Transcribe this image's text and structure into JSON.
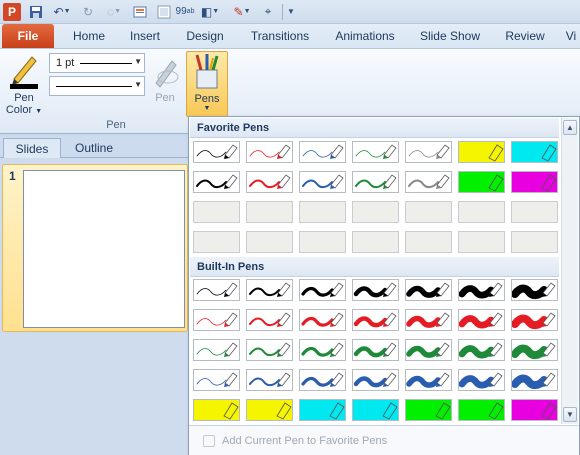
{
  "qat": {
    "logo_letter": "P",
    "icons": [
      "powerpoint-logo-icon",
      "save-icon",
      "undo-icon",
      "redo-icon",
      "repeat-icon",
      "new-slide-icon",
      "print-icon",
      "spelling-icon",
      "shapes-icon",
      "pen-color-icon",
      "pointer-icon",
      "customize-qat-icon"
    ]
  },
  "tabs": [
    "File",
    "Home",
    "Insert",
    "Design",
    "Transitions",
    "Animations",
    "Slide Show",
    "Review",
    "Vi"
  ],
  "ribbon": {
    "pen_color_label_1": "Pen",
    "pen_color_label_2": "Color",
    "thickness_value": "1 pt",
    "pen_disabled_label": "Pen",
    "pens_button_label": "Pens",
    "group_label": "Pen"
  },
  "pane": {
    "tabs": [
      "Slides",
      "Outline"
    ],
    "slide_number": "1"
  },
  "gallery": {
    "favorite_header": "Favorite Pens",
    "builtin_header": "Built-In Pens",
    "footer_label": "Add Current Pen to Favorite Pens",
    "colors": {
      "black": "#000000",
      "red": "#e51c23",
      "blue": "#2a5db0",
      "green": "#1f8a3a",
      "gray": "#888888",
      "yellow": "#f5f500",
      "cyan": "#00e8f0",
      "lime": "#00f000",
      "magenta": "#e800e0"
    },
    "favorites": [
      [
        {
          "color": "black",
          "weight": 1
        },
        {
          "color": "red",
          "weight": 1
        },
        {
          "color": "blue",
          "weight": 1
        },
        {
          "color": "green",
          "weight": 1
        },
        {
          "color": "gray",
          "weight": 1
        },
        {
          "color": "yellow",
          "weight": "hl"
        },
        {
          "color": "cyan",
          "weight": "hl"
        }
      ],
      [
        {
          "color": "black",
          "weight": 2
        },
        {
          "color": "red",
          "weight": 2
        },
        {
          "color": "blue",
          "weight": 2
        },
        {
          "color": "green",
          "weight": 2
        },
        {
          "color": "gray",
          "weight": 2
        },
        {
          "color": "lime",
          "weight": "hl"
        },
        {
          "color": "magenta",
          "weight": "hl"
        }
      ],
      [
        null,
        null,
        null,
        null,
        null,
        null,
        null
      ],
      [
        null,
        null,
        null,
        null,
        null,
        null,
        null
      ]
    ],
    "builtin": [
      [
        {
          "color": "black",
          "weight": 1
        },
        {
          "color": "black",
          "weight": 2
        },
        {
          "color": "black",
          "weight": 3
        },
        {
          "color": "black",
          "weight": 4
        },
        {
          "color": "black",
          "weight": 5
        },
        {
          "color": "black",
          "weight": 6
        },
        {
          "color": "black",
          "weight": 7
        }
      ],
      [
        {
          "color": "red",
          "weight": 1
        },
        {
          "color": "red",
          "weight": 2
        },
        {
          "color": "red",
          "weight": 3
        },
        {
          "color": "red",
          "weight": 4
        },
        {
          "color": "red",
          "weight": 5
        },
        {
          "color": "red",
          "weight": 6
        },
        {
          "color": "red",
          "weight": 7
        }
      ],
      [
        {
          "color": "green",
          "weight": 1
        },
        {
          "color": "green",
          "weight": 2
        },
        {
          "color": "green",
          "weight": 3
        },
        {
          "color": "green",
          "weight": 4
        },
        {
          "color": "green",
          "weight": 5
        },
        {
          "color": "green",
          "weight": 6
        },
        {
          "color": "green",
          "weight": 7
        }
      ],
      [
        {
          "color": "blue",
          "weight": 1
        },
        {
          "color": "blue",
          "weight": 2
        },
        {
          "color": "blue",
          "weight": 3
        },
        {
          "color": "blue",
          "weight": 4
        },
        {
          "color": "blue",
          "weight": 5
        },
        {
          "color": "blue",
          "weight": 6
        },
        {
          "color": "blue",
          "weight": 7
        }
      ],
      [
        {
          "color": "yellow",
          "weight": "hl"
        },
        {
          "color": "yellow",
          "weight": "hl"
        },
        {
          "color": "cyan",
          "weight": "hl"
        },
        {
          "color": "cyan",
          "weight": "hl"
        },
        {
          "color": "lime",
          "weight": "hl"
        },
        {
          "color": "lime",
          "weight": "hl"
        },
        {
          "color": "magenta",
          "weight": "hl"
        }
      ]
    ]
  }
}
